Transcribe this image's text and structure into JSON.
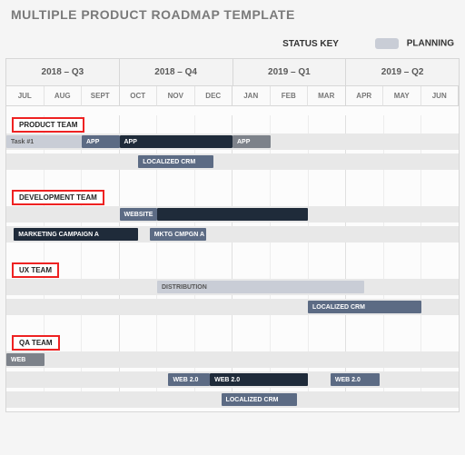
{
  "title": "MULTIPLE PRODUCT ROADMAP TEMPLATE",
  "status_key_label": "STATUS KEY",
  "planning_label": "PLANNING",
  "quarters": [
    "2018 – Q3",
    "2018 – Q4",
    "2019 – Q1",
    "2019 – Q2"
  ],
  "months": [
    "JUL",
    "AUG",
    "SEPT",
    "OCT",
    "NOV",
    "DEC",
    "JAN",
    "FEB",
    "MAR",
    "APR",
    "MAY",
    "JUN"
  ],
  "teams": {
    "product": {
      "label": "PRODUCT TEAM",
      "rows": [
        [
          {
            "label": "Task #1",
            "start": 0,
            "span": 2,
            "style": "plan"
          },
          {
            "label": "APP",
            "start": 2,
            "span": 1,
            "style": "slate"
          },
          {
            "label": "APP",
            "start": 3,
            "span": 3,
            "style": "dark"
          },
          {
            "label": "APP",
            "start": 6,
            "span": 1,
            "style": "grey"
          }
        ],
        [
          {
            "label": "LOCALIZED CRM",
            "start": 3.5,
            "span": 2,
            "style": "slate"
          }
        ]
      ]
    },
    "development": {
      "label": "DEVELOPMENT TEAM",
      "rows": [
        [
          {
            "label": "WEBSITE",
            "start": 3,
            "span": 1,
            "style": "slate"
          },
          {
            "label": "",
            "start": 4,
            "span": 4,
            "style": "dark"
          }
        ],
        [
          {
            "label": "MARKETING CAMPAIGN A",
            "start": 0.2,
            "span": 3.3,
            "style": "dark"
          },
          {
            "label": "MKTG CMPGN A",
            "start": 3.8,
            "span": 1.5,
            "style": "slate"
          }
        ]
      ]
    },
    "ux": {
      "label": "UX TEAM",
      "rows": [
        [
          {
            "label": "DISTRIBUTION",
            "start": 4,
            "span": 5.5,
            "style": "plan"
          }
        ],
        [
          {
            "label": "LOCALIZED CRM",
            "start": 8,
            "span": 3,
            "style": "slate"
          }
        ]
      ]
    },
    "qa": {
      "label": "QA TEAM",
      "rows": [
        [
          {
            "label": "WEB",
            "start": 0,
            "span": 1,
            "style": "grey"
          }
        ],
        [
          {
            "label": "WEB 2.0",
            "start": 4.3,
            "span": 1.1,
            "style": "slate"
          },
          {
            "label": "WEB 2.0",
            "start": 5.4,
            "span": 2.6,
            "style": "dark"
          },
          {
            "label": "WEB 2.0",
            "start": 8.6,
            "span": 1.3,
            "style": "slate"
          }
        ],
        [
          {
            "label": "LOCALIZED CRM",
            "start": 5.7,
            "span": 2,
            "style": "slate"
          }
        ]
      ]
    }
  }
}
